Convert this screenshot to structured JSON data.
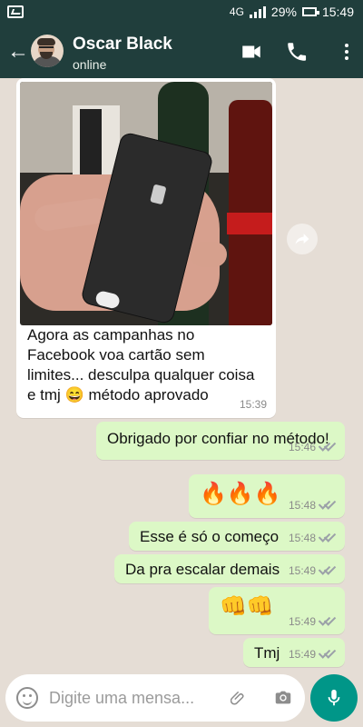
{
  "status": {
    "network": "4G",
    "battery": "29%",
    "time": "15:49"
  },
  "header": {
    "name": "Oscar Black",
    "status": "online"
  },
  "messages": {
    "photo_caption": "Agora as campanhas no Facebook voa cartão sem limites... desculpa qualquer coisa e tmj 😄 método aprovado",
    "photo_time": "15:39",
    "m1_text": "Obrigado por confiar no método!",
    "m1_time": "15:46",
    "m2_text": "🔥🔥🔥",
    "m2_time": "15:48",
    "m3_text": "Esse é só o começo",
    "m3_time": "15:48",
    "m4_text": "Da pra escalar demais",
    "m4_time": "15:49",
    "m5_text": "👊👊",
    "m5_time": "15:49",
    "m6_text": "Tmj",
    "m6_time": "15:49"
  },
  "composer": {
    "placeholder": "Digite uma mensa..."
  },
  "colors": {
    "header": "#203e3c",
    "chat_bg": "#e5ddd5",
    "incoming": "#ffffff",
    "outgoing": "#dcf8c6",
    "mic": "#009688"
  },
  "icons": {
    "back": "arrow-left-icon",
    "video": "video-camera-icon",
    "phone": "phone-icon",
    "menu": "more-vertical-icon",
    "forward": "forward-icon",
    "emoji": "emoji-icon",
    "attach": "paperclip-icon",
    "camera": "camera-icon",
    "mic": "microphone-icon"
  }
}
